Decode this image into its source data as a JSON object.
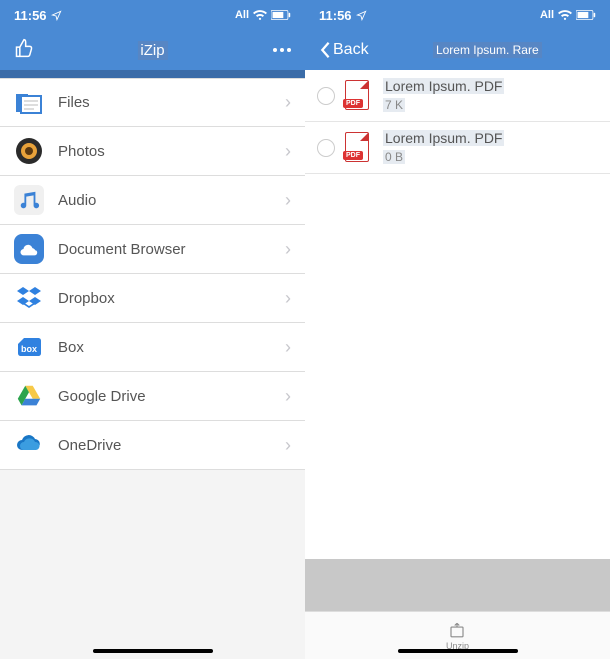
{
  "status": {
    "time": "11:56",
    "carrier": "All"
  },
  "left": {
    "title": "iZip",
    "items": [
      {
        "label": "Files"
      },
      {
        "label": "Photos"
      },
      {
        "label": "Audio"
      },
      {
        "label": "Document Browser"
      },
      {
        "label": "Dropbox"
      },
      {
        "label": "Box"
      },
      {
        "label": "Google Drive"
      },
      {
        "label": "OneDrive"
      }
    ]
  },
  "right": {
    "back": "Back",
    "folder": "Lorem Ipsum. Rare",
    "files": [
      {
        "name": "Lorem Ipsum. PDF",
        "size": "7 K"
      },
      {
        "name": "Lorem Ipsum. PDF",
        "size": "0 B"
      }
    ],
    "toolbar": {
      "unzip": "Unzip"
    }
  }
}
